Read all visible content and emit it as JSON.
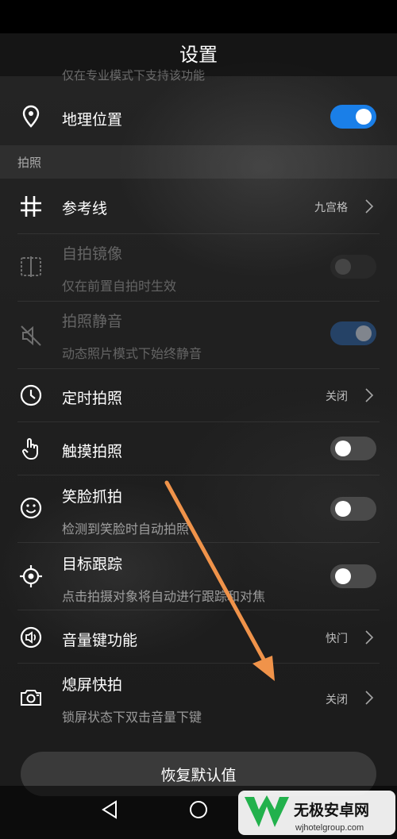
{
  "header": {
    "title": "设置"
  },
  "ghost_text": "仅在专业模式下支持该功能",
  "section_label": "拍照",
  "rows": {
    "location": {
      "label": "地理位置",
      "toggle": "on"
    },
    "gridlines": {
      "label": "参考线",
      "value": "九宫格"
    },
    "mirror": {
      "label": "自拍镜像",
      "sub": "仅在前置自拍时生效",
      "toggle": "off"
    },
    "mute": {
      "label": "拍照静音",
      "sub": "动态照片模式下始终静音",
      "toggle": "on"
    },
    "timer": {
      "label": "定时拍照",
      "value": "关闭"
    },
    "touch": {
      "label": "触摸拍照",
      "toggle": "off"
    },
    "smile": {
      "label": "笑脸抓拍",
      "sub": "检测到笑脸时自动拍照",
      "toggle": "off"
    },
    "tracking": {
      "label": "目标跟踪",
      "sub": "点击拍摄对象将自动进行跟踪和对焦",
      "toggle": "off"
    },
    "volume": {
      "label": "音量键功能",
      "value": "快门"
    },
    "ultra": {
      "label": "熄屏快拍",
      "sub": "锁屏状态下双击音量下键",
      "value": "关闭"
    }
  },
  "reset_button": {
    "label": "恢复默认值"
  },
  "watermark": {
    "main": "无极安卓网",
    "url": "wjhotelgroup.com"
  },
  "colors": {
    "accent": "#1a7fe8",
    "arrow": "#f0934a"
  }
}
